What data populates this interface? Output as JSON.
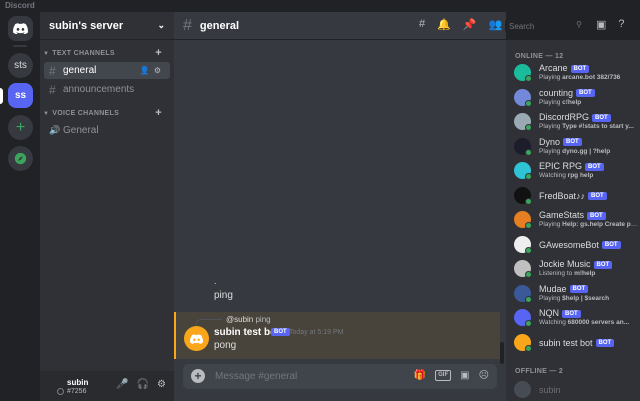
{
  "app": {
    "name": "Discord"
  },
  "servers": [
    {
      "id": "home",
      "label": ""
    },
    {
      "id": "sts",
      "label": "sts"
    },
    {
      "id": "ss",
      "label": "ss"
    },
    {
      "id": "add",
      "label": "+"
    },
    {
      "id": "explore",
      "label": ""
    }
  ],
  "server": {
    "name": "subin's server",
    "categories": {
      "text": "TEXT CHANNELS",
      "voice": "VOICE CHANNELS"
    },
    "text_channels": [
      "general",
      "announcements"
    ],
    "voice_channels": [
      "General"
    ]
  },
  "user": {
    "name": "subin",
    "tag": "#7256"
  },
  "chat": {
    "channel": "general",
    "messages": [
      {
        "text": "."
      },
      {
        "text": "ping"
      }
    ],
    "highlighted": {
      "reply_mention": "@subin",
      "reply_text": "ping",
      "author": "subin test bot",
      "badge": "BOT",
      "time": "Today at 5:19 PM",
      "text": "pong"
    },
    "composer_placeholder": "Message #general",
    "gif_label": "GIF"
  },
  "search": {
    "placeholder": "Search"
  },
  "members": {
    "online_header": "ONLINE — 12",
    "offline_header": "OFFLINE — 2",
    "online": [
      {
        "name": "Arcane",
        "bot": "BOT",
        "activity_prefix": "Playing ",
        "activity": "arcane.bot 382/736",
        "color": "#1abc9c"
      },
      {
        "name": "counting",
        "bot": "BOT",
        "activity_prefix": "Playing ",
        "activity": "c!help",
        "color": "#7289da"
      },
      {
        "name": "DiscordRPG",
        "bot": "BOT",
        "activity_prefix": "Playing ",
        "activity": "Type #!stats to start y...",
        "color": "#99aab5"
      },
      {
        "name": "Dyno",
        "bot": "BOT",
        "activity_prefix": "Playing ",
        "activity": "dyno.gg | ?help",
        "color": "#1b1d2b"
      },
      {
        "name": "EPIC RPG",
        "bot": "BOT",
        "activity_prefix": "Watching ",
        "activity": "rpg help",
        "color": "#2ec4d6"
      },
      {
        "name": "FredBoat♪♪",
        "bot": "BOT",
        "activity_prefix": "",
        "activity": "",
        "color": "#111111"
      },
      {
        "name": "GameStats",
        "bot": "BOT",
        "activity_prefix": "Playing ",
        "activity": "Help: gs.help Create pr...",
        "color": "#e67e22"
      },
      {
        "name": "GAwesomeBot",
        "bot": "BOT",
        "activity_prefix": "",
        "activity": "",
        "color": "#eeeeee"
      },
      {
        "name": "Jockie Music",
        "bot": "BOT",
        "activity_prefix": "Listening to ",
        "activity": "m!help",
        "color": "#c0c0c0"
      },
      {
        "name": "Mudae",
        "bot": "BOT",
        "activity_prefix": "Playing ",
        "activity": "$help | $search",
        "color": "#3b5998"
      },
      {
        "name": "NQN",
        "bot": "BOT",
        "activity_prefix": "Watching ",
        "activity": "680000 servers an...",
        "color": "#5865f2"
      },
      {
        "name": "subin test bot",
        "bot": "BOT",
        "activity_prefix": "",
        "activity": "",
        "color": "#faa61a"
      }
    ],
    "offline": [
      {
        "name": "subin",
        "color": "#747f8d"
      }
    ]
  }
}
